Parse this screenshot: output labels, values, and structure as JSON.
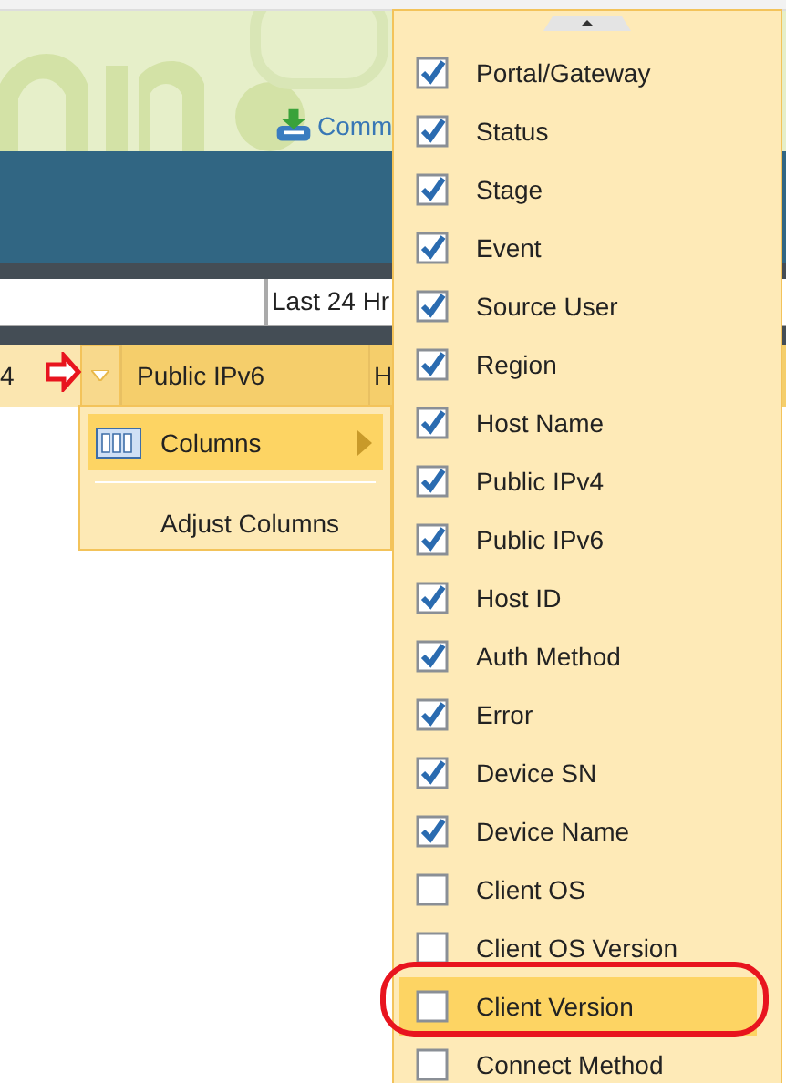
{
  "commit_link": "Comm",
  "time_range": "Last 24 Hr",
  "table_header": {
    "columns": [
      "4",
      "Public IPv6",
      "H"
    ]
  },
  "context_menu": {
    "items": [
      {
        "label": "Columns",
        "kind": "submenu",
        "selected": true
      },
      {
        "label": "Adjust Columns",
        "kind": "plain",
        "selected": false
      }
    ]
  },
  "columns_menu": {
    "items": [
      {
        "label": "Portal/Gateway",
        "checked": true,
        "selected": false
      },
      {
        "label": "Status",
        "checked": true,
        "selected": false
      },
      {
        "label": "Stage",
        "checked": true,
        "selected": false
      },
      {
        "label": "Event",
        "checked": true,
        "selected": false
      },
      {
        "label": "Source User",
        "checked": true,
        "selected": false
      },
      {
        "label": "Region",
        "checked": true,
        "selected": false
      },
      {
        "label": "Host Name",
        "checked": true,
        "selected": false
      },
      {
        "label": "Public IPv4",
        "checked": true,
        "selected": false
      },
      {
        "label": "Public IPv6",
        "checked": true,
        "selected": false
      },
      {
        "label": "Host ID",
        "checked": true,
        "selected": false
      },
      {
        "label": "Auth Method",
        "checked": true,
        "selected": false
      },
      {
        "label": "Error",
        "checked": true,
        "selected": false
      },
      {
        "label": "Device SN",
        "checked": true,
        "selected": false
      },
      {
        "label": "Device Name",
        "checked": true,
        "selected": false
      },
      {
        "label": "Client OS",
        "checked": false,
        "selected": false
      },
      {
        "label": "Client OS Version",
        "checked": false,
        "selected": false
      },
      {
        "label": "Client Version",
        "checked": false,
        "selected": true
      },
      {
        "label": "Connect Method",
        "checked": false,
        "selected": false
      }
    ]
  }
}
